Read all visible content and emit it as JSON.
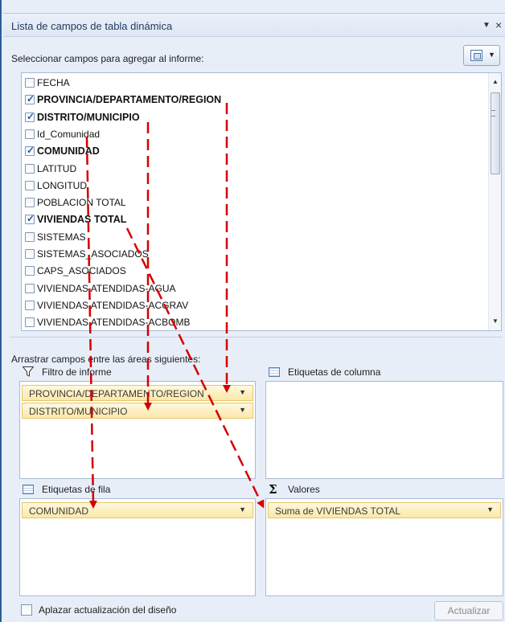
{
  "panel": {
    "title": "Lista de campos de tabla dinámica",
    "menu_arrow": "▼",
    "close": "×"
  },
  "field_section": {
    "label": "Seleccionar campos para agregar al informe:",
    "fields": [
      {
        "name": "FECHA",
        "checked": false
      },
      {
        "name": "PROVINCIA/DEPARTAMENTO/REGION",
        "checked": true
      },
      {
        "name": "DISTRITO/MUNICIPIO",
        "checked": true
      },
      {
        "name": "Id_Comunidad",
        "checked": false
      },
      {
        "name": "COMUNIDAD",
        "checked": true
      },
      {
        "name": "LATITUD",
        "checked": false
      },
      {
        "name": "LONGITUD",
        "checked": false
      },
      {
        "name": "POBLACION TOTAL",
        "checked": false
      },
      {
        "name": "VIVIENDAS TOTAL",
        "checked": true
      },
      {
        "name": "SISTEMAS",
        "checked": false
      },
      {
        "name": "SISTEMAS_ASOCIADOS",
        "checked": false
      },
      {
        "name": "CAPS_ASOCIADOS",
        "checked": false
      },
      {
        "name": "VIVIENDAS ATENDIDAS-AGUA",
        "checked": false
      },
      {
        "name": "VIVIENDAS ATENDIDAS-ACGRAV",
        "checked": false
      },
      {
        "name": "VIVIENDAS ATENDIDAS-ACBOMB",
        "checked": false
      }
    ]
  },
  "areas": {
    "label": "Arrastrar campos entre las áreas siguientes:",
    "report_filter": {
      "title": "Filtro de informe",
      "items": [
        "PROVINCIA/DEPARTAMENTO/REGION",
        "DISTRITO/MUNICIPIO"
      ]
    },
    "column_labels": {
      "title": "Etiquetas de columna",
      "items": []
    },
    "row_labels": {
      "title": "Etiquetas de fila",
      "items": [
        "COMUNIDAD"
      ]
    },
    "values": {
      "title": "Valores",
      "items": [
        "Suma de VIVIENDAS TOTAL"
      ]
    }
  },
  "footer": {
    "defer_label": "Aplazar actualización del diseño",
    "defer_checked": false,
    "update_label": "Actualizar"
  },
  "colors": {
    "accent": "#2a5d9a",
    "pill_fill": "#fbe8a8",
    "annotation_arrow": "#d40000"
  }
}
